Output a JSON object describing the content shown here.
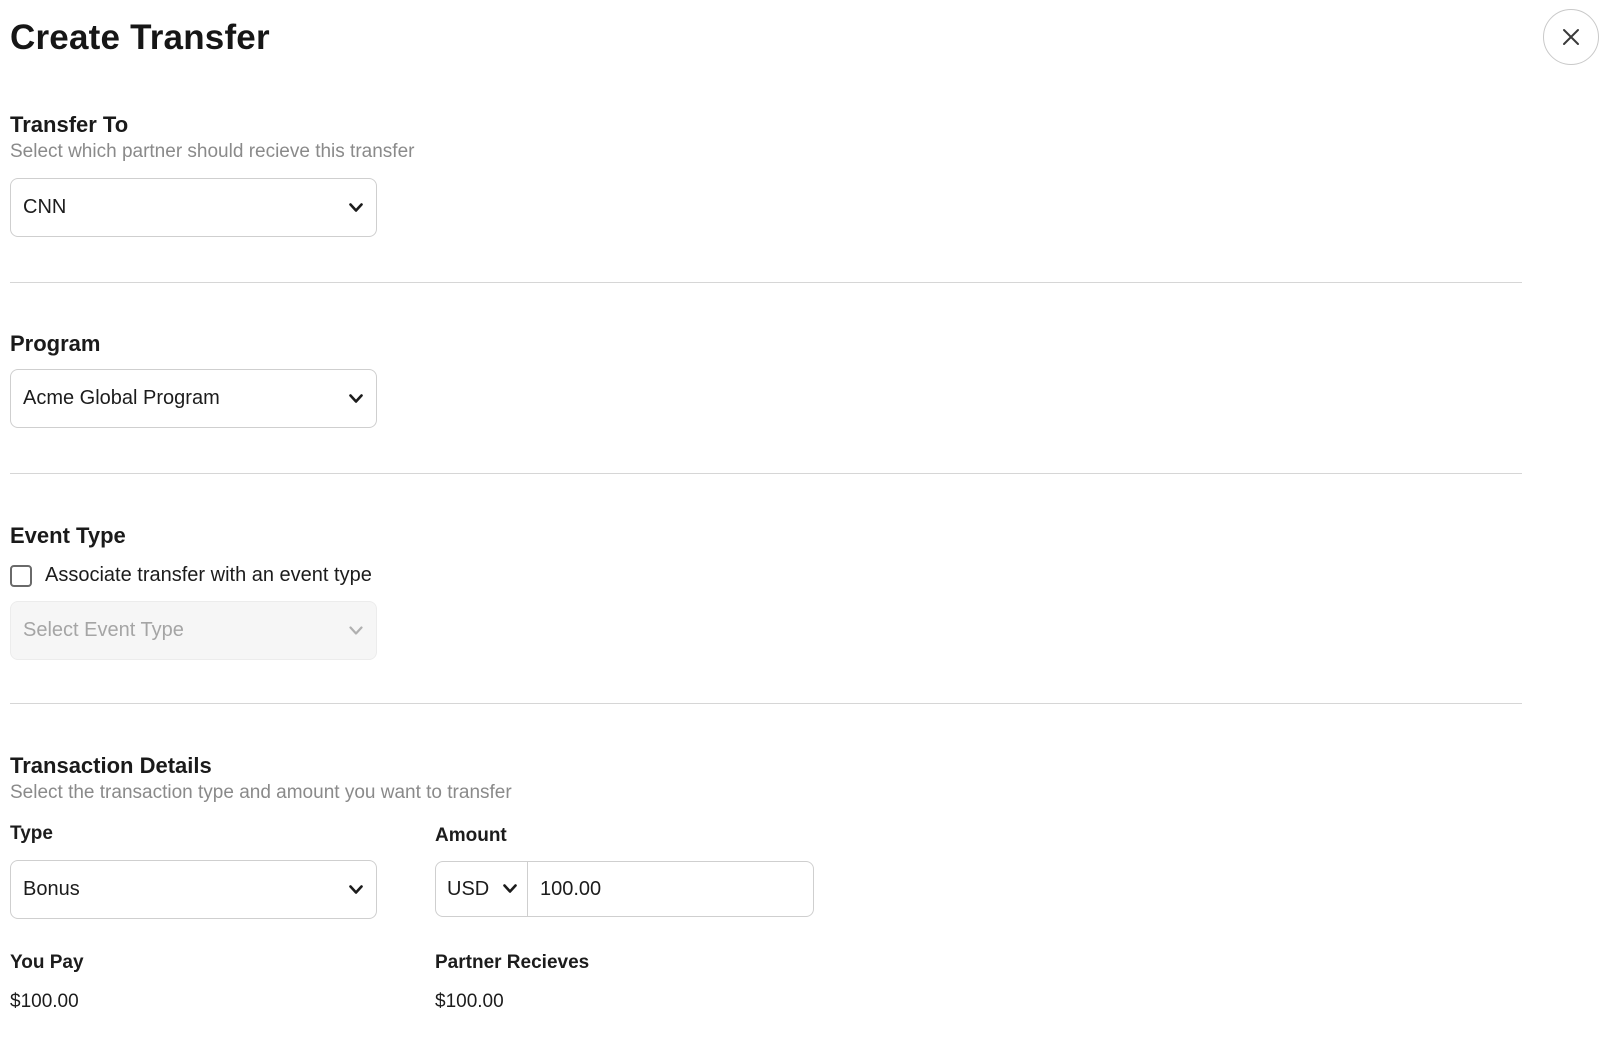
{
  "header": {
    "title": "Create Transfer",
    "close_icon": "close-icon"
  },
  "transfer_to": {
    "title": "Transfer To",
    "subtitle": "Select which partner should recieve this transfer",
    "selected": "CNN"
  },
  "program": {
    "title": "Program",
    "selected": "Acme Global Program"
  },
  "event_type": {
    "title": "Event Type",
    "checkbox_label": "Associate transfer with an event type",
    "checkbox_checked": false,
    "select_placeholder": "Select Event Type",
    "select_disabled": true
  },
  "transaction": {
    "title": "Transaction Details",
    "subtitle": "Select the transaction type and amount you want to transfer",
    "type_label": "Type",
    "type_selected": "Bonus",
    "amount_label": "Amount",
    "currency": "USD",
    "amount_value": "100.00",
    "you_pay_label": "You Pay",
    "you_pay_value": "$100.00",
    "partner_receives_label": "Partner Recieves",
    "partner_receives_value": "$100.00"
  },
  "colors": {
    "text": "#1c1c1c",
    "muted": "#8a8a8a",
    "border": "#cfcfcf",
    "divider": "#d6d6d6",
    "disabled_bg": "#f6f6f6"
  }
}
